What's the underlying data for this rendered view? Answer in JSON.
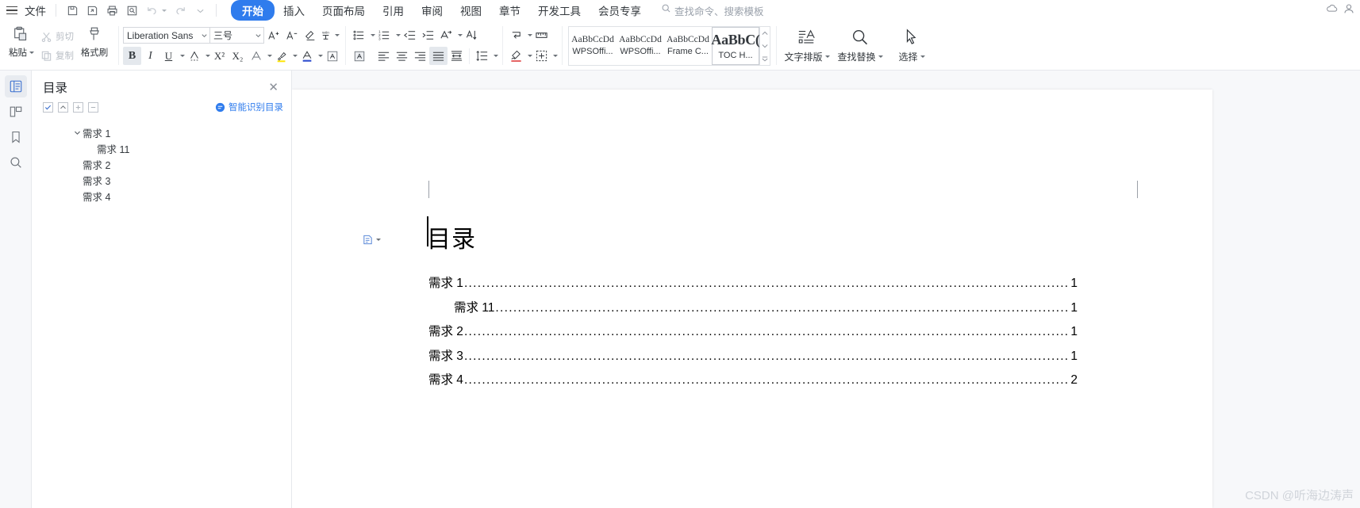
{
  "app": {
    "brand_accent": "#2f7ced",
    "file_menu": "文件",
    "search_placeholder": "查找命令、搜索模板"
  },
  "quick_access": [
    {
      "name": "save-icon",
      "tip": "保存"
    },
    {
      "name": "save-as-icon",
      "tip": "另存为"
    },
    {
      "name": "print-icon",
      "tip": "打印"
    },
    {
      "name": "print-preview-icon",
      "tip": "打印预览"
    },
    {
      "name": "undo-icon",
      "tip": "撤销"
    },
    {
      "name": "redo-icon",
      "tip": "恢复"
    },
    {
      "name": "customize-chevron-icon",
      "tip": "自定义快速访问工具栏"
    }
  ],
  "tabs": [
    {
      "label": "开始",
      "active": true
    },
    {
      "label": "插入",
      "active": false
    },
    {
      "label": "页面布局",
      "active": false
    },
    {
      "label": "引用",
      "active": false
    },
    {
      "label": "审阅",
      "active": false
    },
    {
      "label": "视图",
      "active": false
    },
    {
      "label": "章节",
      "active": false
    },
    {
      "label": "开发工具",
      "active": false
    },
    {
      "label": "会员专享",
      "active": false
    }
  ],
  "ribbon": {
    "clipboard": {
      "paste": "粘贴",
      "cut": "剪切",
      "copy": "复制",
      "format_brush": "格式刷"
    },
    "font": {
      "name_value": "Liberation Sans",
      "size_value": "三号",
      "buttons": [
        {
          "name": "grow-font-icon",
          "glyph": "A⁺"
        },
        {
          "name": "shrink-font-icon",
          "glyph": "A⁻"
        },
        {
          "name": "clear-format-icon",
          "glyph": "◇"
        },
        {
          "name": "pinyin-guide-icon",
          "glyph": "文"
        },
        {
          "name": "bold-icon",
          "glyph": "B",
          "active": true
        },
        {
          "name": "italic-icon",
          "glyph": "I"
        },
        {
          "name": "underline-icon",
          "glyph": "U"
        },
        {
          "name": "strikethrough-icon",
          "glyph": "A"
        },
        {
          "name": "superscript-icon",
          "glyph": "X²"
        },
        {
          "name": "subscript-icon",
          "glyph": "X₂"
        },
        {
          "name": "text-effect-icon",
          "glyph": "A"
        },
        {
          "name": "highlight-color-icon",
          "glyph": "✎"
        },
        {
          "name": "font-color-icon",
          "glyph": "A"
        },
        {
          "name": "character-border-icon",
          "glyph": "A"
        }
      ]
    },
    "paragraph": {
      "buttons": [
        {
          "name": "bullet-list-icon"
        },
        {
          "name": "numbered-list-icon"
        },
        {
          "name": "decrease-indent-icon"
        },
        {
          "name": "increase-indent-icon"
        },
        {
          "name": "multilevel-list-icon"
        },
        {
          "name": "sort-icon"
        },
        {
          "name": "align-left-icon"
        },
        {
          "name": "align-center-icon"
        },
        {
          "name": "align-right-icon"
        },
        {
          "name": "align-justify-icon",
          "active": true
        },
        {
          "name": "distribute-icon"
        },
        {
          "name": "line-spacing-icon"
        },
        {
          "name": "show-marks-icon"
        },
        {
          "name": "ruler-icon"
        },
        {
          "name": "shading-icon"
        },
        {
          "name": "borders-icon"
        }
      ]
    },
    "styles": [
      {
        "preview": "AaBbCcDd",
        "name": "WPSOffi...",
        "selected": false,
        "big": false
      },
      {
        "preview": "AaBbCcDd",
        "name": "WPSOffi...",
        "selected": false,
        "big": false
      },
      {
        "preview": "AaBbCcDd",
        "name": "Frame C...",
        "selected": false,
        "big": false
      },
      {
        "preview": "AaBbC(",
        "name": "TOC H...",
        "selected": true,
        "big": true
      }
    ],
    "right_buttons": [
      {
        "label": "文字排版",
        "icon": "text-typeset-icon",
        "dropdown": true
      },
      {
        "label": "查找替换",
        "icon": "find-replace-icon",
        "dropdown": true
      },
      {
        "label": "选择",
        "icon": "select-icon",
        "dropdown": true
      }
    ]
  },
  "left_rail": [
    {
      "name": "rail-outline-icon",
      "active": true
    },
    {
      "name": "rail-thumbnail-icon",
      "active": false
    },
    {
      "name": "rail-bookmark-icon",
      "active": false
    },
    {
      "name": "rail-search-icon",
      "active": false
    }
  ],
  "nav_pane": {
    "title": "目录",
    "close_label": "✕",
    "smart_toc_label": "智能识别目录",
    "tool_buttons": [
      {
        "name": "toc-check-icon",
        "glyph": "✓"
      },
      {
        "name": "toc-collapse-up-icon",
        "glyph": "▲"
      },
      {
        "name": "toc-expand-icon",
        "glyph": "+"
      },
      {
        "name": "toc-collapse-icon",
        "glyph": "−"
      }
    ],
    "items": [
      {
        "label": "需求 1",
        "level": 1,
        "expanded": true
      },
      {
        "label": "需求 11",
        "level": 2,
        "expanded": false
      },
      {
        "label": "需求 2",
        "level": 1,
        "expanded": false
      },
      {
        "label": "需求 3",
        "level": 1,
        "expanded": false
      },
      {
        "label": "需求 4",
        "level": 1,
        "expanded": false
      }
    ]
  },
  "document": {
    "heading": "目录",
    "toc_entries": [
      {
        "text": "需求 1",
        "page": "1",
        "indent": false
      },
      {
        "text": "需求 11",
        "page": "1",
        "indent": true
      },
      {
        "text": "需求 2",
        "page": "1",
        "indent": false
      },
      {
        "text": "需求 3",
        "page": "1",
        "indent": false
      },
      {
        "text": "需求 4",
        "page": "2",
        "indent": false
      }
    ],
    "leader": "......................................................................................................................................................."
  },
  "watermark": "CSDN @听海边涛声"
}
